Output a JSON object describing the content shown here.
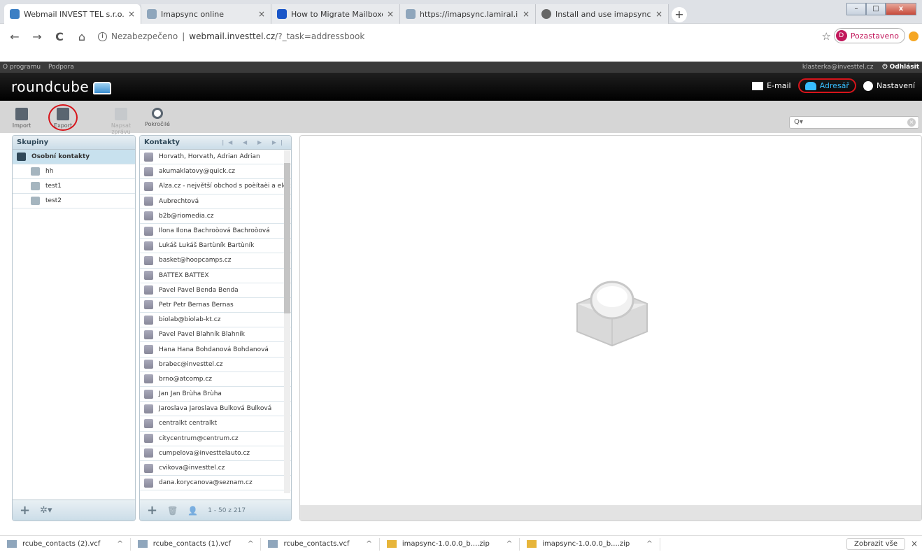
{
  "browser": {
    "tabs": [
      {
        "title": "Webmail INVEST TEL s.r.o. :: Adre",
        "close": "×",
        "active": true
      },
      {
        "title": "Imapsync online",
        "close": "×",
        "active": false
      },
      {
        "title": "How to Migrate Mailboxes Easily",
        "close": "×",
        "active": false
      },
      {
        "title": "https://imapsync.lamiral.info/REA",
        "close": "×",
        "active": false
      },
      {
        "title": "Install and use imapsync on Ubu",
        "close": "×",
        "active": false
      }
    ],
    "new_tab": "+",
    "window_buttons": {
      "minimize": "–",
      "maximize": "□",
      "close": "x"
    },
    "nav": {
      "back": "←",
      "forward": "→",
      "reload": "C",
      "home": "⌂"
    },
    "url_insecure": "Nezabezpečeno",
    "url_separator": "|",
    "url_domain": "webmail.investtel.cz",
    "url_path": "/?_task=addressbook",
    "star": "☆",
    "profile": {
      "initial": "D",
      "label": "Pozastaveno"
    }
  },
  "rc": {
    "toplinks": {
      "about": "O programu",
      "support": "Podpora",
      "user": "klasterka@investtel.cz",
      "logout": "⏻ Odhlásit"
    },
    "logo_text": "roundcube",
    "nav": {
      "mail": "E-mail",
      "addressbook": "Adresář",
      "settings": "Nastavení"
    },
    "toolbar": {
      "import": "Import",
      "export": "Export",
      "compose": "Napsat zprávu",
      "advanced": "Pokročilé"
    },
    "search": {
      "icon": "Q▾",
      "clear": "×"
    },
    "groups": {
      "header": "Skupiny",
      "items": [
        "Osobní kontakty",
        "hh",
        "test1",
        "test2"
      ],
      "footer": {
        "add": "+",
        "settings": "✲▾"
      }
    },
    "contacts": {
      "header": "Kontakty",
      "pager": "|◀ ◀ ▶ ▶|",
      "items": [
        "Horvath, Horvath, Adrian Adrian",
        "akumaklatovy@quick.cz",
        "Alza.cz - největší obchod s poèítaèi a elek",
        "Aubrechtová",
        "b2b@riomedia.cz",
        "Ilona Ilona Bachroòová Bachroòová",
        "Lukáš Lukáš Bartùník Bartùník",
        "basket@hoopcamps.cz",
        "BATTEX BATTEX",
        "Pavel Pavel Benda Benda",
        "Petr Petr Bernas Bernas",
        "biolab@biolab-kt.cz",
        "Pavel Pavel Blahník Blahník",
        "Hana Hana Bohdanová Bohdanová",
        "brabec@investtel.cz",
        "brno@atcomp.cz",
        "Jan Jan Brùha Brùha",
        "Jaroslava Jaroslava Bulková Bulková",
        "centralkt centralkt",
        "citycentrum@centrum.cz",
        "cumpelova@investtelauto.cz",
        "cvikova@investtel.cz",
        "dana.korycanova@seznam.cz"
      ],
      "footer": {
        "add": "+",
        "delete": "🗑",
        "count": "1 - 50 z 217"
      }
    }
  },
  "downloads": {
    "items": [
      {
        "name": "rcube_contacts (2).vcf",
        "type": "vcf"
      },
      {
        "name": "rcube_contacts (1).vcf",
        "type": "vcf"
      },
      {
        "name": "rcube_contacts.vcf",
        "type": "vcf"
      },
      {
        "name": "imapsync-1.0.0.0_b....zip",
        "type": "zip"
      },
      {
        "name": "imapsync-1.0.0.0_b....zip",
        "type": "zip"
      }
    ],
    "chevron": "^",
    "show_all": "Zobrazit vše",
    "close": "×"
  },
  "colors": {
    "accent": "#37beff",
    "highlight_circle": "#d7141a",
    "header_bg": "#000000",
    "panel_header": "#cbdde8"
  }
}
